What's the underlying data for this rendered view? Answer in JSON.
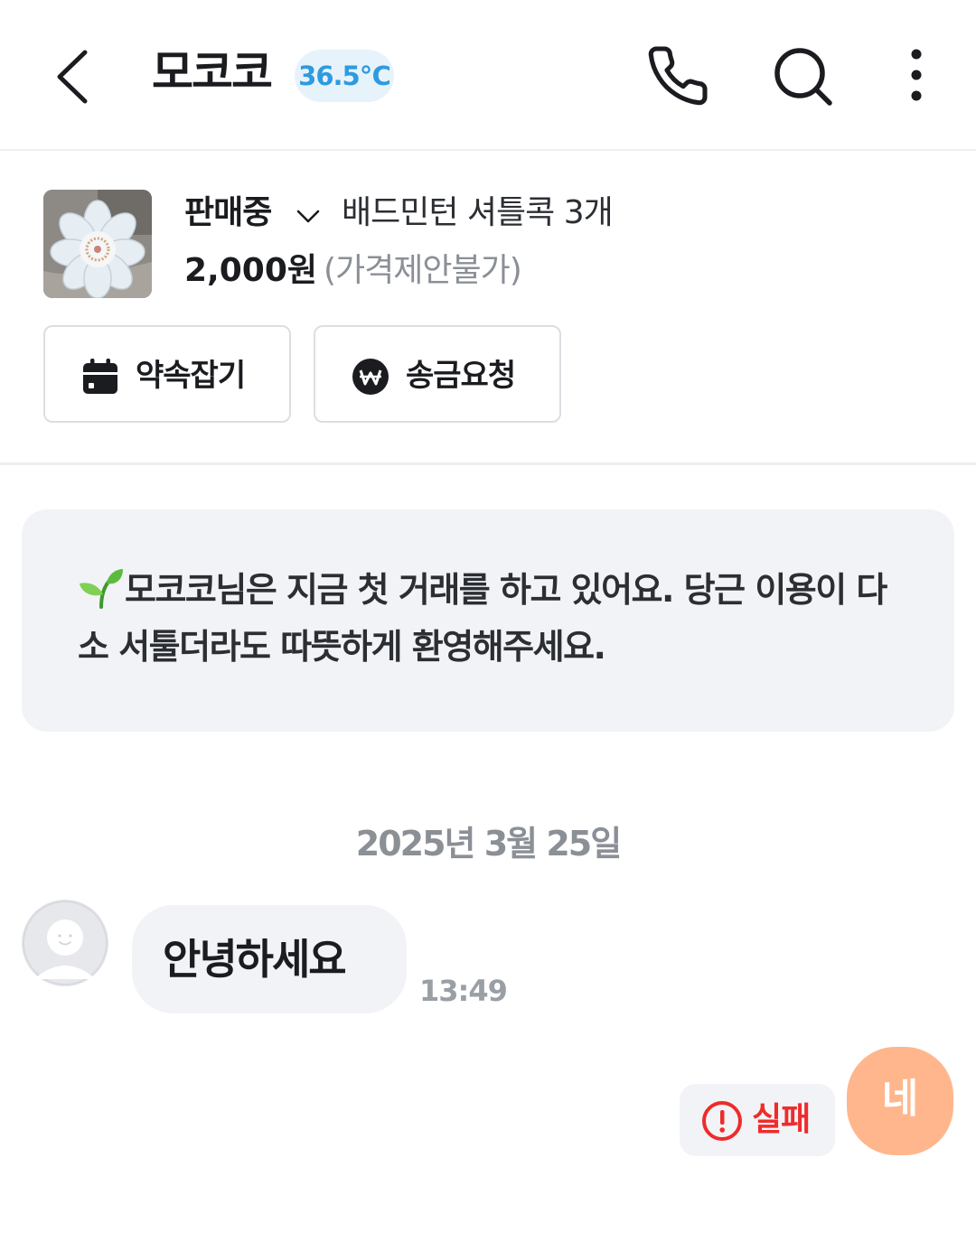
{
  "header": {
    "title": "모코코",
    "temperature": "36.5℃",
    "back_icon": "chevron-left-icon",
    "call_icon": "phone-icon",
    "search_icon": "search-icon",
    "more_icon": "more-vertical-icon"
  },
  "product": {
    "status": "판매중",
    "name": "배드민턴 셔틀콕 3개",
    "price": "2,000원",
    "negotiation": "(가격제안불가)"
  },
  "actions": {
    "appointment_label": "약속잡기",
    "remit_label": "송금요청"
  },
  "notice": {
    "text": "모코코님은 지금 첫 거래를 하고 있어요. 당근 이용이 다소 서툴더라도 따뜻하게 환영해주세요."
  },
  "chat": {
    "date": "2025년 3월 25일",
    "messages": [
      {
        "from": "other",
        "text": "안녕하세요",
        "time": "13:49"
      },
      {
        "from": "me",
        "text": "네",
        "status": "실패"
      }
    ]
  },
  "colors": {
    "temperature_text": "#2e9be0",
    "temperature_bg": "#e7f3fb",
    "outgoing_bubble": "#ffb68c",
    "error": "#ee2c2c"
  }
}
